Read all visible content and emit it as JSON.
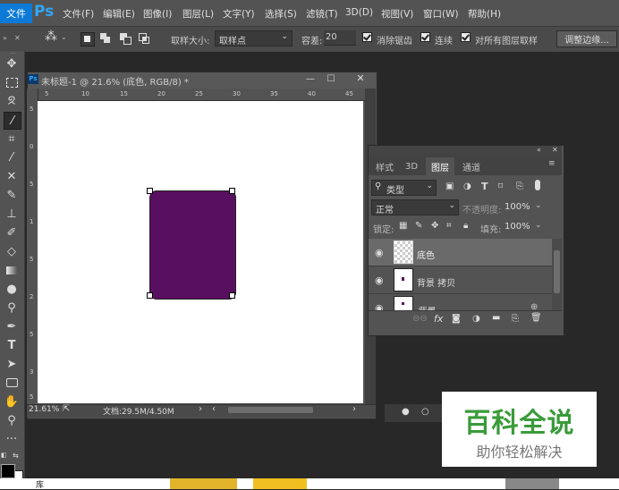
{
  "app": {
    "logo": "Ps"
  },
  "menubar": {
    "file": "文件",
    "items": [
      "文件(F)",
      "编辑(E)",
      "图像(I)",
      "图层(L)",
      "文字(Y)",
      "选择(S)",
      "滤镜(T)",
      "3D(D)",
      "视图(V)",
      "窗口(W)",
      "帮助(H)"
    ]
  },
  "options": {
    "sample_size_label": "取样大小:",
    "sample_size_value": "取样点",
    "tolerance_label": "容差:",
    "tolerance_value": "20",
    "antialias": "消除锯齿",
    "contiguous": "连续",
    "sample_all": "对所有图层取样",
    "refine_edge": "调整边缘..."
  },
  "document": {
    "title": "未标题-1 @ 21.6% (底色, RGB/8) *",
    "ruler_top": [
      "5",
      "10",
      "15",
      "20",
      "25",
      "30",
      "35",
      "40",
      "45"
    ],
    "ruler_left": [
      "5",
      "0",
      "5",
      "1",
      "5",
      "2",
      "5",
      "3",
      "5"
    ],
    "zoom": "21.61%",
    "doc_info": "文档:29.5M/4.50M"
  },
  "layers_panel": {
    "tabs": [
      "样式",
      "3D",
      "图层",
      "通道"
    ],
    "active_tab": "图层",
    "filter": "类型",
    "blend_mode": "正常",
    "opacity_label": "不透明度:",
    "opacity_value": "100%",
    "lock_label": "锁定:",
    "fill_label": "填充:",
    "fill_value": "100%",
    "layers": [
      {
        "name": "底色",
        "selected": true
      },
      {
        "name": "背景 拷贝",
        "selected": false
      },
      {
        "name": "背景",
        "selected": false
      }
    ],
    "footer_icons": [
      "link-icon",
      "fx-icon",
      "mask-icon",
      "adjustment-icon",
      "folder-icon",
      "new-layer-icon",
      "trash-icon"
    ]
  },
  "colors": {
    "shape": "#590f5f",
    "accent": "#0c7ad6",
    "panel": "#535353"
  },
  "watermark": {
    "title": "百科全说",
    "subtitle": "助你轻松解决"
  },
  "taskbar": {
    "label": "库"
  }
}
